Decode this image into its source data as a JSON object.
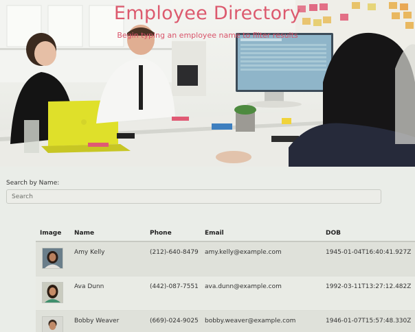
{
  "hero": {
    "title": "Employee Directory",
    "subtitle": "Begin typing an employee name to filter results"
  },
  "search": {
    "label": "Search by Name:",
    "placeholder": "Search"
  },
  "table": {
    "headers": [
      "Image",
      "Name",
      "Phone",
      "Email",
      "DOB"
    ],
    "rows": [
      {
        "name": "Amy Kelly",
        "phone": "(212)-640-8479",
        "email": "amy.kelly@example.com",
        "dob": "1945-01-04T16:40:41.927Z"
      },
      {
        "name": "Ava Dunn",
        "phone": "(442)-087-7551",
        "email": "ava.dunn@example.com",
        "dob": "1992-03-11T13:27:12.482Z"
      },
      {
        "name": "Bobby Weaver",
        "phone": "(669)-024-9025",
        "email": "bobby.weaver@example.com",
        "dob": "1946-01-07T15:57:48.330Z"
      }
    ]
  },
  "colors": {
    "title_accent": "#dc5a6e",
    "background": "#eaede8"
  }
}
